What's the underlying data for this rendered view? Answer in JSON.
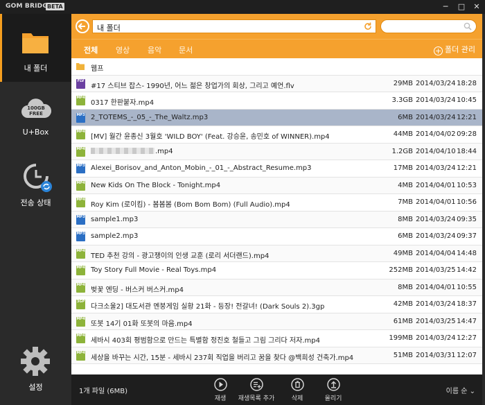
{
  "window": {
    "app_title": "GOM BRIDGE",
    "badge": "BETA",
    "minimize": "─",
    "maximize": "□",
    "close": "✕"
  },
  "sidebar": {
    "items": [
      {
        "label": "내 폴더",
        "icon": "folder-icon",
        "active": true
      },
      {
        "label": "U+Box",
        "icon": "cloud-100gb-icon",
        "active": false,
        "badge_line1": "100GB",
        "badge_line2": "FREE"
      },
      {
        "label": "전송 상태",
        "icon": "transfer-clock-icon",
        "active": false
      },
      {
        "label": "설정",
        "icon": "gear-icon",
        "active": false
      }
    ]
  },
  "toolbar": {
    "path": "내 폴더",
    "search_placeholder": ""
  },
  "tabs": [
    {
      "label": "전체",
      "active": true
    },
    {
      "label": "영상",
      "active": false
    },
    {
      "label": "음악",
      "active": false
    },
    {
      "label": "문서",
      "active": false
    }
  ],
  "folder_manage": "폴더 관리",
  "files": [
    {
      "type": "folder",
      "name": "웹프",
      "size": "",
      "date": "",
      "time": ""
    },
    {
      "type": "flv",
      "name": "#17 스티브 잡스- 1990년, 어느 젊은 창업가의 회상, 그리고 예언.flv",
      "size": "29MB",
      "date": "2014/03/24",
      "time": "18:28"
    },
    {
      "type": "mp4",
      "name": "0317 한판붙자.mp4",
      "size": "3.3GB",
      "date": "2014/03/24",
      "time": "10:45"
    },
    {
      "type": "mp3",
      "name": "2_TOTEMS_-_05_-_The_Waltz.mp3",
      "size": "6MB",
      "date": "2014/03/24",
      "time": "12:21",
      "selected": true
    },
    {
      "type": "mp4",
      "name": "[MV] 월간 윤종신 3월호 'WILD BOY' (Feat. 강승윤, 송민호 of WINNER).mp4",
      "size": "44MB",
      "date": "2014/04/02",
      "time": "09:28"
    },
    {
      "type": "mp4",
      "name": ".mp4",
      "size": "1.2GB",
      "date": "2014/04/10",
      "time": "18:44",
      "blurred": true
    },
    {
      "type": "mp3",
      "name": "Alexei_Borisov_and_Anton_Mobin_-_01_-_Abstract_Resume.mp3",
      "size": "17MB",
      "date": "2014/03/24",
      "time": "12:21"
    },
    {
      "type": "mp4",
      "name": "New Kids On The Block - Tonight.mp4",
      "size": "4MB",
      "date": "2014/04/01",
      "time": "10:53"
    },
    {
      "type": "mp4",
      "name": "Roy Kim (로이킴) - 봄봄봄 (Bom Bom Bom) (Full Audio).mp4",
      "size": "7MB",
      "date": "2014/04/01",
      "time": "10:56"
    },
    {
      "type": "mp3",
      "name": "sample1.mp3",
      "size": "8MB",
      "date": "2014/03/24",
      "time": "09:35"
    },
    {
      "type": "mp3",
      "name": "sample2.mp3",
      "size": "6MB",
      "date": "2014/03/24",
      "time": "09:37"
    },
    {
      "type": "mp4",
      "name": "TED 추천 강의 - 광고쟁이의 인생 교훈 (로리 서더랜드).mp4",
      "size": "49MB",
      "date": "2014/04/04",
      "time": "14:48"
    },
    {
      "type": "mp4",
      "name": "Toy Story Full Movie - Real Toys.mp4",
      "size": "252MB",
      "date": "2014/03/25",
      "time": "14:42"
    },
    {
      "type": "mp4",
      "name": "벚꽃 엔딩 - 버스커 버스커.mp4",
      "size": "8MB",
      "date": "2014/04/01",
      "time": "10:55"
    },
    {
      "type": "3gp",
      "name": "다크소울2] 대도서관 멘붕게임 실황 21화 - 등장! 전갈녀! (Dark Souls 2).3gp",
      "size": "42MB",
      "date": "2014/03/24",
      "time": "18:37"
    },
    {
      "type": "mp4",
      "name": "또봇 14기   01화 또봇의 마음.mp4",
      "size": "61MB",
      "date": "2014/03/25",
      "time": "14:47"
    },
    {
      "type": "mp4",
      "name": "세바시 403회 평범함으로 만드는 특별함 정진호 철들고 그림 그리다 저자.mp4",
      "size": "199MB",
      "date": "2014/03/24",
      "time": "12:27"
    },
    {
      "type": "mp4",
      "name": "세상을 바꾸는 시간, 15분 - 세바시 237회 직업을 버리고 꿈을 찾다 @백희성 건축가.mp4",
      "size": "51MB",
      "date": "2014/03/31",
      "time": "12:07"
    }
  ],
  "file_type_colors": {
    "mp4": "#8db33a",
    "mp3": "#2b6fc4",
    "flv": "#6a3fa0",
    "3gp": "#8db33a",
    "folder": "#f0b23a"
  },
  "file_type_badges": {
    "mp4": "MP4",
    "mp3": "MP3",
    "flv": "FLV",
    "3gp": "3GP"
  },
  "bottom": {
    "file_count": "1개 파일 (6MB)",
    "actions": [
      {
        "label": "재생",
        "icon": "play-icon"
      },
      {
        "label": "재생목록 추가",
        "icon": "add-playlist-icon"
      },
      {
        "label": "삭제",
        "icon": "trash-icon"
      },
      {
        "label": "올리기",
        "icon": "upload-icon"
      }
    ],
    "sort_label": "이름 순"
  },
  "colors": {
    "accent": "#f5a12e",
    "sidebar_bg": "#2a2a2a",
    "selected_row": "#a9b5c9"
  }
}
